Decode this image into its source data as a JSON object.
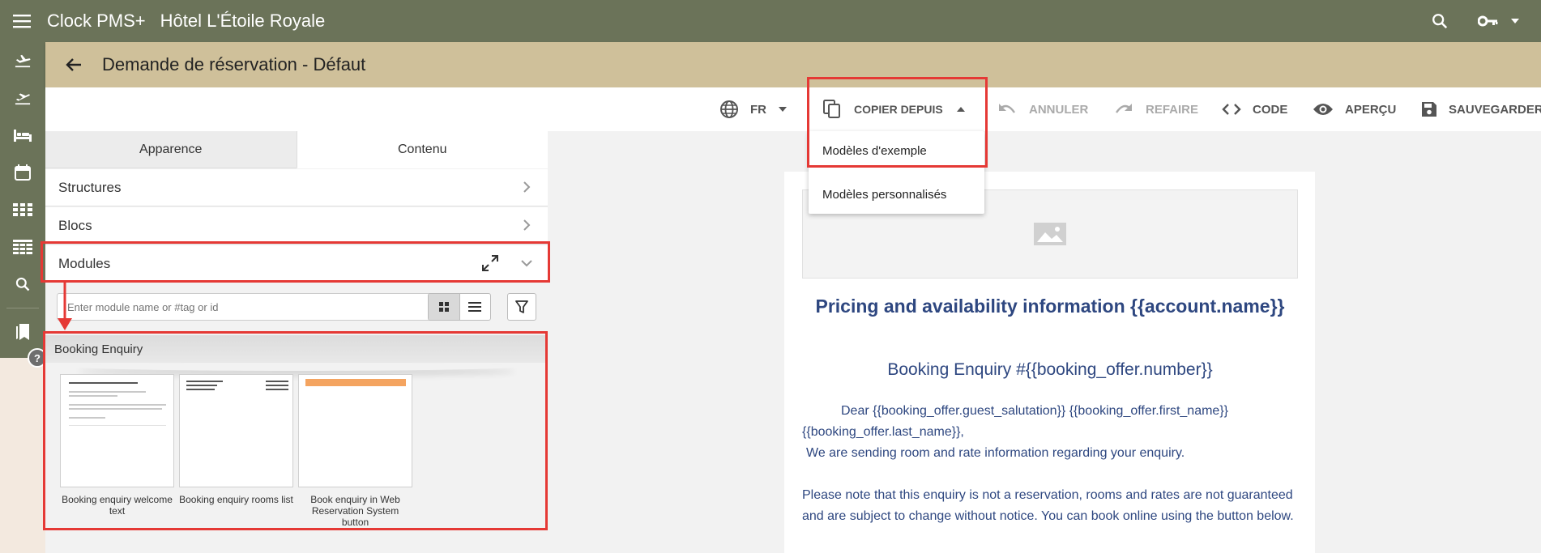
{
  "topbar": {
    "app_title": "Clock PMS+",
    "hotel_name": "Hôtel L'Étoile Royale",
    "icons": [
      "menu-icon",
      "search-icon",
      "key-icon",
      "caret-down-icon"
    ]
  },
  "sidebar": {
    "icons": [
      "flight-land-icon",
      "flight-takeoff-icon",
      "bed-icon",
      "calendar-icon",
      "grid-icon",
      "table-icon",
      "search-icon",
      "bookmarks-icon"
    ],
    "help_label": "?"
  },
  "page": {
    "title": "Demande de réservation - Défaut"
  },
  "toolbar": {
    "language": "FR",
    "copy_from": "COPIER DEPUIS",
    "undo": "ANNULER",
    "redo": "REFAIRE",
    "code": "CODE",
    "preview": "APERÇU",
    "save": "SAUVEGARDER"
  },
  "copy_menu": {
    "items": [
      "Modèles d'exemple",
      "Modèles personnalisés"
    ]
  },
  "panel": {
    "tabs": [
      "Apparence",
      "Contenu"
    ],
    "active_tab": "Contenu",
    "sections": [
      "Structures",
      "Blocs",
      "Modules"
    ],
    "search_placeholder": "Enter module name or #tag or id",
    "group_name": "Booking Enquiry",
    "modules": [
      {
        "caption": "Booking enquiry welcome text"
      },
      {
        "caption": "Booking enquiry rooms list"
      },
      {
        "caption": "Book enquiry in Web Reservation System button"
      }
    ]
  },
  "preview": {
    "heading": "Pricing and availability information {{account.name}}",
    "subheading": "Booking Enquiry #{{booking_offer.number}}",
    "greeting": "Dear {{booking_offer.guest_salutation}} {{booking_offer.first_name}} {{booking_offer.last_name}},",
    "line1": "We are sending room and rate information regarding your enquiry.",
    "paragraph2": "Please note that this enquiry is not a reservation, rooms and rates are not guaranteed and are subject to change without notice. You can book online using the button below."
  },
  "colors": {
    "topbar": "#6b7359",
    "header": "#cfc09a",
    "preview_text": "#2e4780",
    "annotation": "#e53935"
  }
}
